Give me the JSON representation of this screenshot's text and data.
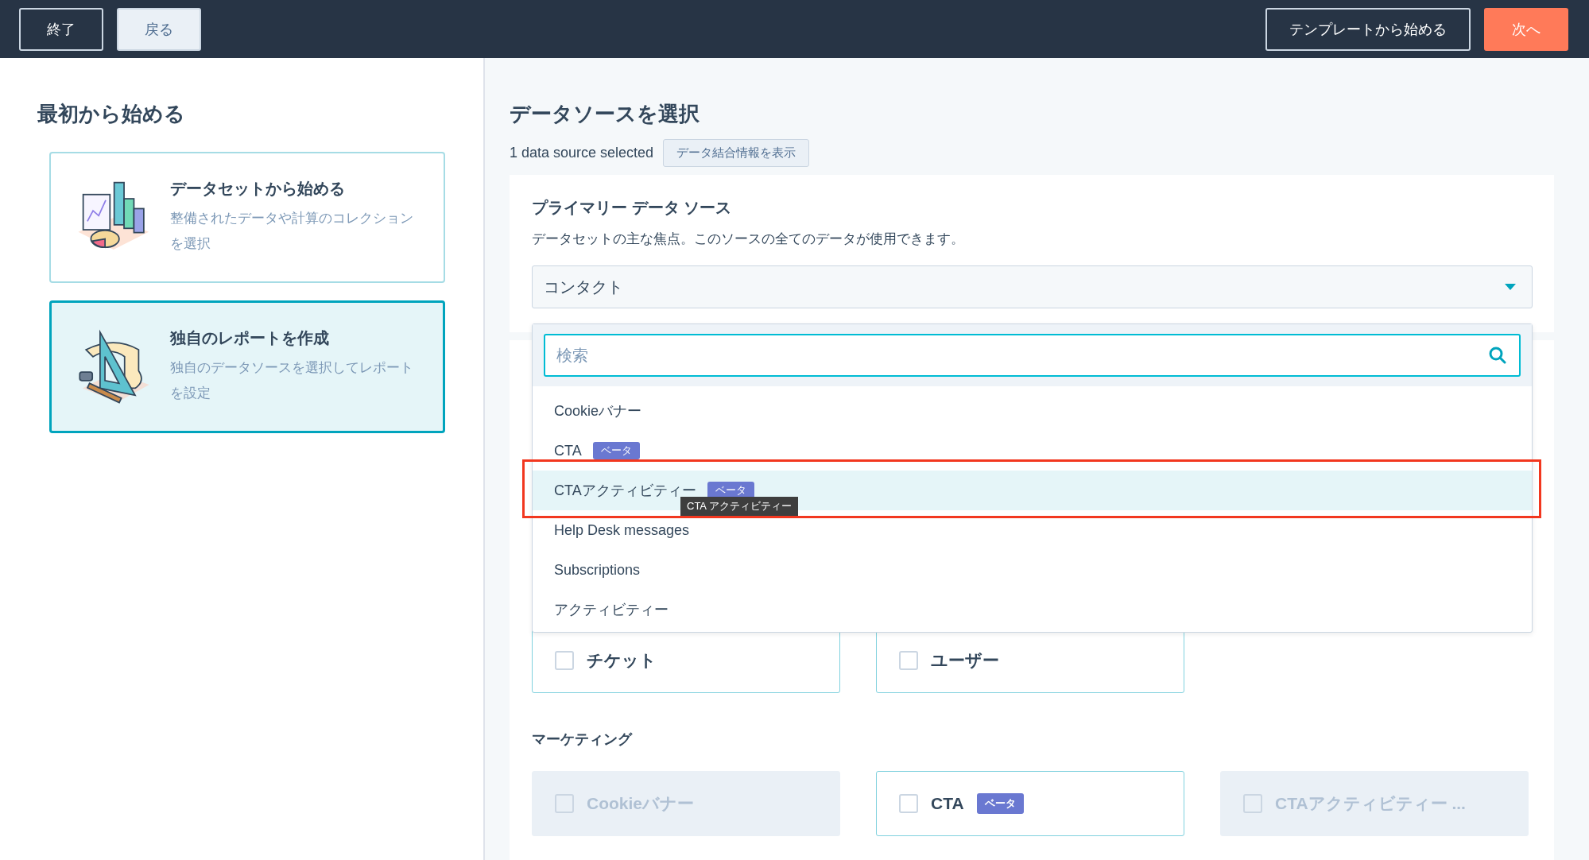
{
  "top_bar": {
    "left_buttons": [
      {
        "label": "終了",
        "kind": "outline"
      },
      {
        "label": "戻る",
        "kind": "light"
      }
    ],
    "right_buttons": [
      {
        "label": "テンプレートから始める",
        "kind": "outline"
      },
      {
        "label": "次へ",
        "kind": "primary"
      }
    ]
  },
  "start_panel": {
    "title": "最初から始める",
    "options": [
      {
        "title": "データセットから始める",
        "description": "整備されたデータや計算のコレクションを選択",
        "selected": false,
        "kind": "charts"
      },
      {
        "title": "独自のレポートを作成",
        "description": "独自のデータソースを選択してレポートを設定",
        "selected": true,
        "kind": "tools"
      }
    ]
  },
  "data_source": {
    "title": "データソースを選択",
    "selected_count": "1 data source selected",
    "join_info_button": "データ結合情報を表示",
    "primary": {
      "title": "プライマリー データ ソース",
      "description": "データセットの主な焦点。このソースの全てのデータが使用できます。",
      "value": "コンタクト",
      "dropdown": {
        "placeholder": "検索",
        "items": [
          {
            "label": "Cookieバナー",
            "highlighted": false
          },
          {
            "label": "CTA",
            "badge": "ベータ",
            "highlighted": false
          },
          {
            "label": "CTAアクティビティー",
            "badge": "ベータ",
            "highlighted": true,
            "outlined": true,
            "tooltip": "CTA アクティビティー"
          },
          {
            "label": "Help Desk messages",
            "highlighted": false
          },
          {
            "label": "Subscriptions",
            "highlighted": false
          },
          {
            "label": "アクティビティー",
            "highlighted": false
          }
        ]
      }
    },
    "objects": [
      {
        "label": "チケット",
        "checked": false,
        "disabled": false
      },
      {
        "label": "ユーザー",
        "checked": false,
        "disabled": false
      }
    ],
    "marketing": {
      "title": "マーケティング",
      "cards": [
        {
          "label": "Cookieバナー",
          "checked": false,
          "disabled": true
        },
        {
          "label": "CTA",
          "badge": "ベータ",
          "checked": false,
          "disabled": false
        },
        {
          "label": "CTAアクティビティー ...",
          "checked": false,
          "disabled": true
        }
      ]
    }
  }
}
